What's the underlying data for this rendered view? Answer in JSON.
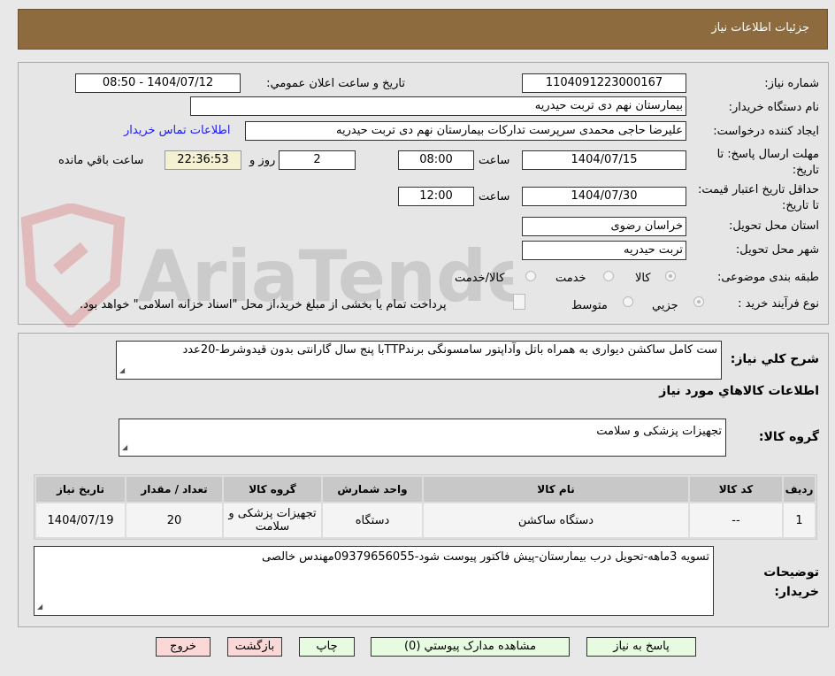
{
  "header": {
    "title": "جزئیات اطلاعات نیاز"
  },
  "watermark": "AriaTender.neT",
  "fields": {
    "need_number_label": "شماره نیاز:",
    "need_number": "1104091223000167",
    "announce_label": "تاریخ و ساعت اعلان عمومي:",
    "announce_value": "1404/07/12 - 08:50",
    "buyer_org_label": "نام دستگاه خریدار:",
    "buyer_org": "بیمارستان نهم دی تربت حیدریه",
    "creator_label": "ایجاد کننده درخواست:",
    "creator": "علیرضا حاجی محمدی سرپرست تدارکات بیمارستان نهم دی تربت حیدریه",
    "contact_link": "اطلاعات تماس خریدار",
    "deadline_label": "مهلت ارسال پاسخ: تا تاریخ:",
    "deadline_date": "1404/07/15",
    "time_label": "ساعت",
    "deadline_time": "08:00",
    "days": "2",
    "days_label": "روز و",
    "remaining": "22:36:53",
    "remaining_label": "ساعت باقي مانده",
    "validity_label": "حداقل تاریخ اعتبار قیمت: تا تاریخ:",
    "validity_date": "1404/07/30",
    "validity_time": "12:00",
    "province_label": "استان محل تحویل:",
    "province": "خراسان رضوی",
    "city_label": "شهر محل تحویل:",
    "city": "تربت حیدریه",
    "category_label": "طبقه بندی موضوعی:",
    "category_options": [
      "کالا",
      "خدمت",
      "کالا/خدمت"
    ],
    "process_label": "نوع فرآیند خرید :",
    "process_options": [
      "جزیي",
      "متوسط"
    ],
    "payment_note": "پرداخت تمام یا بخشی از مبلغ خرید،از محل \"اسناد خزانه اسلامی\" خواهد بود."
  },
  "details": {
    "desc_label": "شرح کلي نیاز:",
    "desc": "ست کامل ساکشن دیواری به همراه باتل وآداپتور سامسونگی برندTTPبا پنج سال گارانتی بدون قیدوشرط-20عدد",
    "goods_heading": "اطلاعات کالاهاي مورد نیاز",
    "group_label": "گروه کالا:",
    "group": "تجهیزات پزشکی و سلامت",
    "table": {
      "headers": [
        "ردیف",
        "کد کالا",
        "نام کالا",
        "واحد شمارش",
        "گروه کالا",
        "تعداد / مقدار",
        "تاریخ نیاز"
      ],
      "rows": [
        [
          "1",
          "--",
          "دستگاه ساکشن",
          "دستگاه",
          "تجهیزات پزشکی و سلامت",
          "20",
          "1404/07/19"
        ]
      ]
    },
    "notes_label": "توضیحات خریدار:",
    "notes": "تسویه 3ماهه-تحویل درب بیمارستان-پیش فاکتور پیوست شود-09379656055مهندس خالصی"
  },
  "buttons": {
    "reply": "پاسخ به نیاز",
    "attachments": "مشاهده مدارک پیوستي (0)",
    "print": "چاپ",
    "back": "بازگشت",
    "exit": "خروج"
  }
}
